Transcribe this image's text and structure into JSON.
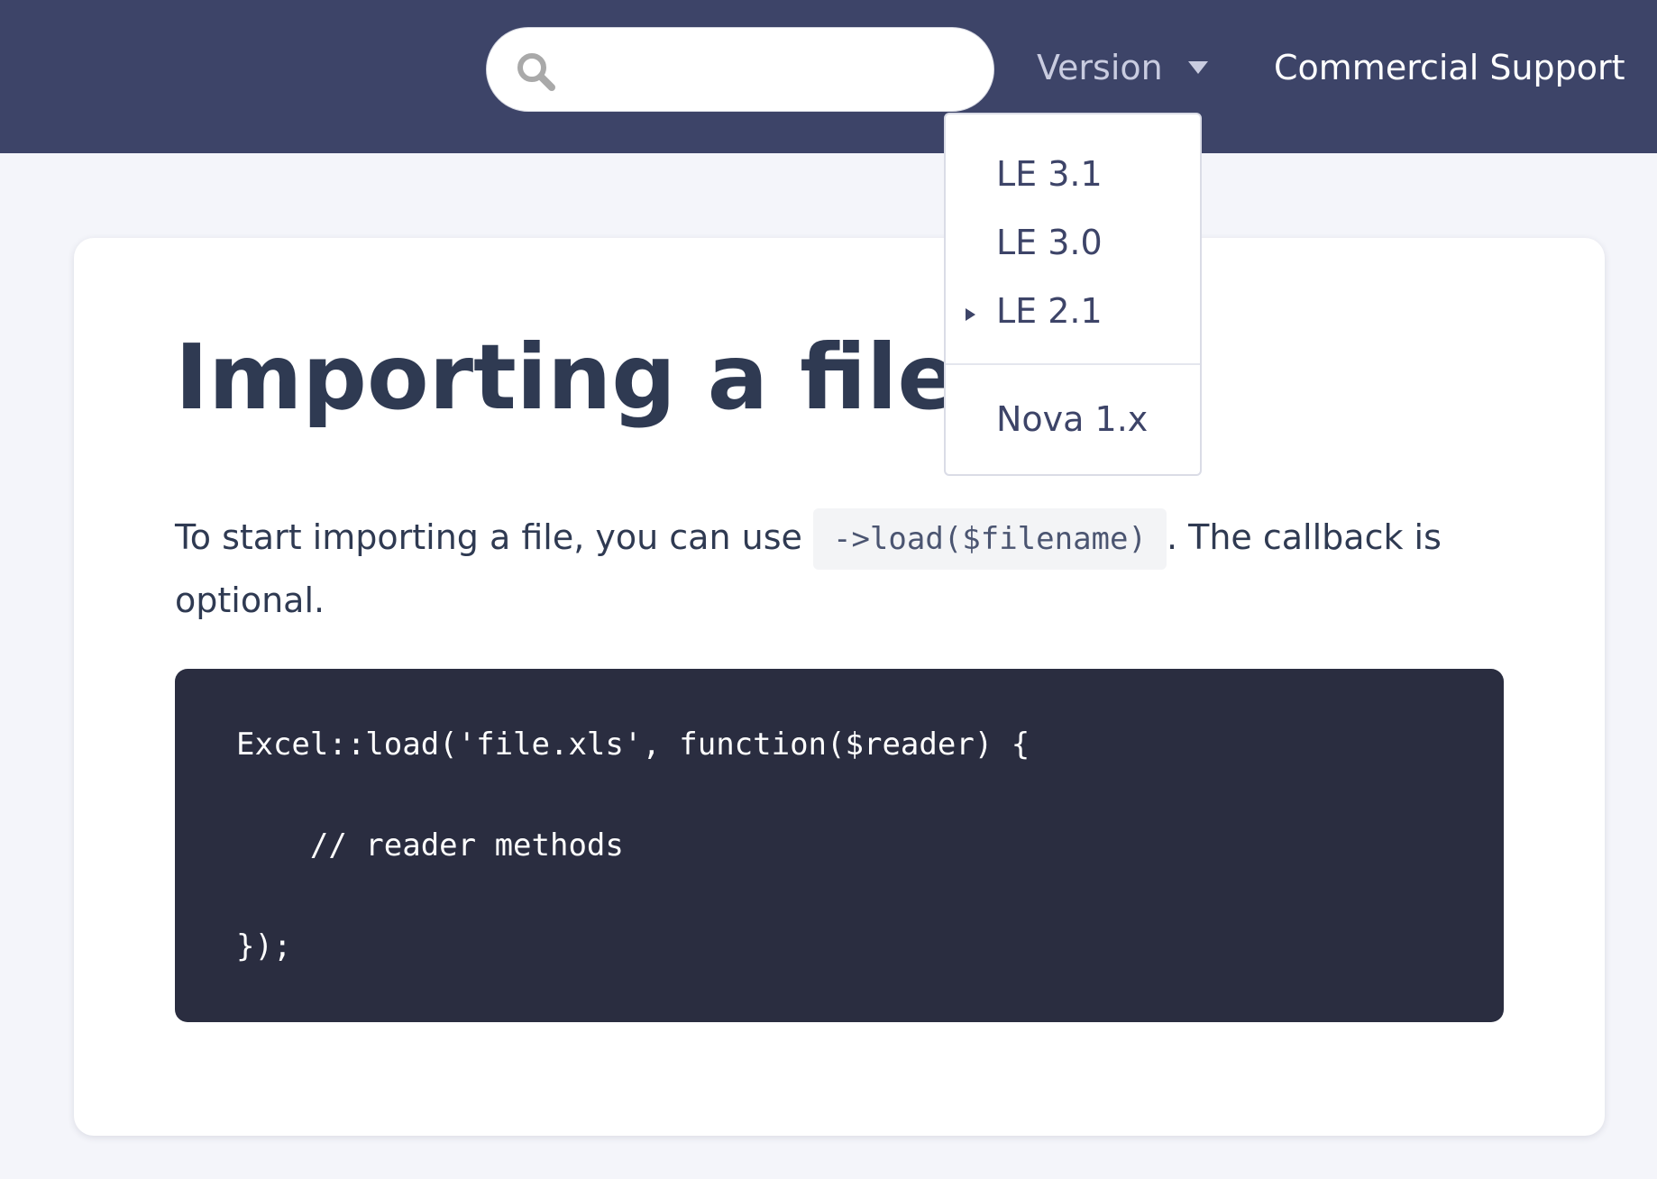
{
  "header": {
    "search": {
      "placeholder": "",
      "value": ""
    },
    "version_label": "Version",
    "commercial_support_label": "Commercial Support",
    "background_color": "#3d4468"
  },
  "version_dropdown": {
    "items": [
      {
        "label": "LE 3.1",
        "active": false
      },
      {
        "label": "LE 3.0",
        "active": false
      },
      {
        "label": "LE 2.1",
        "active": true
      },
      {
        "label": "Nova 1.x",
        "active": false
      }
    ]
  },
  "content": {
    "title": "Importing a file",
    "paragraph": {
      "before": "To start importing a file, you can use ",
      "code": "->load($filename)",
      "after": ". The callback is optional."
    },
    "code_block": {
      "lines": [
        "Excel::load('file.xls', function($reader) {",
        "    // reader methods",
        "});"
      ]
    }
  },
  "icons": {
    "search": "search-icon",
    "dropdown_caret": "caret-down-icon",
    "active_version": "triangle-right-icon"
  }
}
